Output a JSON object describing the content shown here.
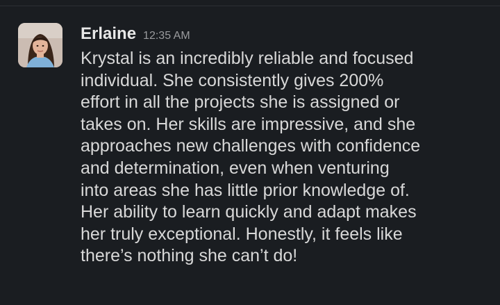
{
  "message": {
    "sender": "Erlaine",
    "timestamp": "12:35 AM",
    "avatar_icon": "user-photo-avatar",
    "lines": [
      "Krystal is an incredibly reliable and focused",
      "individual. She consistently gives 200%",
      "effort in all the projects she is assigned or",
      "takes on. Her skills are impressive, and she",
      "approaches new challenges with confidence",
      "and determination, even when venturing",
      "into areas she has little prior knowledge of.",
      "Her ability to learn quickly and adapt makes",
      "her truly exceptional. Honestly, it feels like",
      "there’s nothing she can’t do!"
    ]
  },
  "colors": {
    "background": "#1a1d21",
    "sender": "#e8e8e8",
    "timestamp": "#9a9b9e",
    "text": "#d8d8d8"
  }
}
